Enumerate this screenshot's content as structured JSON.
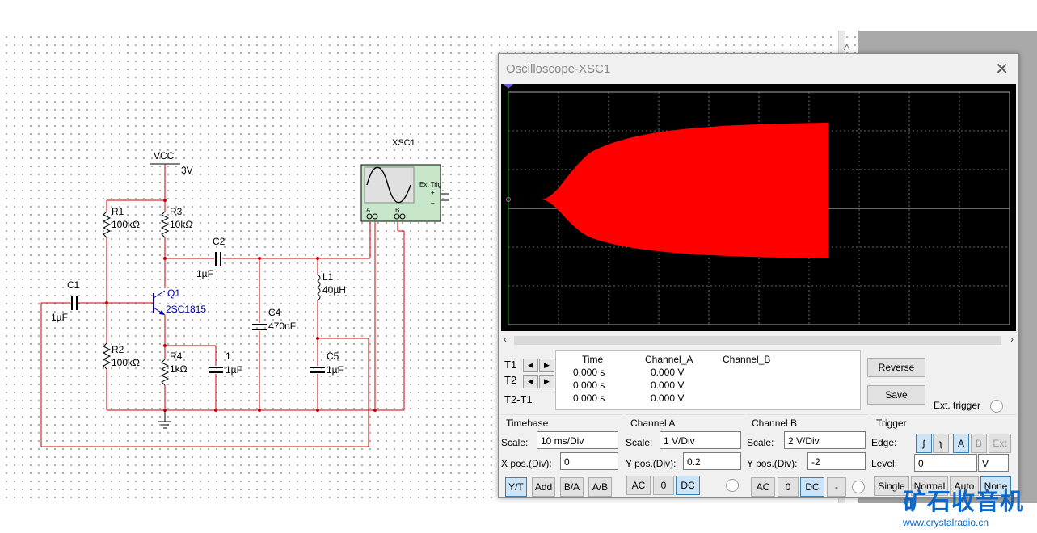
{
  "schematic": {
    "vcc_label": "VCC",
    "vcc_value": "3V",
    "scope_ref": "XSC1",
    "scope_ext_trig": "Ext Trig",
    "scope_a": "A",
    "scope_b": "B",
    "scope_plus": "+",
    "scope_minus": "_",
    "components": {
      "r1_name": "R1",
      "r1_value": "100kΩ",
      "r3_name": "R3",
      "r3_value": "10kΩ",
      "c2_name": "C2",
      "c2_value": "1µF",
      "c1_name": "C1",
      "c1_value": "1µF",
      "q1_name": "Q1",
      "q1_value": "2SC1815",
      "r2_name": "R2",
      "r2_value": "100kΩ",
      "r4_name": "R4",
      "r4_value": "1kΩ",
      "cx_name": "1",
      "cx_value": "1µF",
      "c4_name": "C4",
      "c4_value": "470nF",
      "l1_name": "L1",
      "l1_value": "40µH",
      "c5_name": "C5",
      "c5_value": "1µF"
    },
    "right_edge_letter": "A"
  },
  "oscilloscope": {
    "title": "Oscilloscope-XSC1",
    "trace_color": "#ff0000",
    "cursor": {
      "t1": "T1",
      "t2": "T2",
      "t2t1": "T2-T1",
      "headers": [
        "Time",
        "Channel_A",
        "Channel_B"
      ],
      "rows": [
        [
          "0.000 s",
          "0.000 V",
          ""
        ],
        [
          "0.000 s",
          "0.000 V",
          ""
        ],
        [
          "0.000 s",
          "0.000 V",
          ""
        ]
      ]
    },
    "buttons": {
      "reverse": "Reverse",
      "save": "Save",
      "ext_trigger": "Ext. trigger"
    },
    "timebase": {
      "title": "Timebase",
      "scale_label": "Scale:",
      "scale_value": "10 ms/Div",
      "xpos_label": "X pos.(Div):",
      "xpos_value": "0",
      "modes": [
        "Y/T",
        "Add",
        "B/A",
        "A/B"
      ],
      "selected_mode": "Y/T"
    },
    "channel_a": {
      "title": "Channel A",
      "scale_label": "Scale:",
      "scale_value": "1  V/Div",
      "ypos_label": "Y pos.(Div):",
      "ypos_value": "0.2",
      "coupling": [
        "AC",
        "0",
        "DC"
      ],
      "selected_coupling": "DC"
    },
    "channel_b": {
      "title": "Channel B",
      "scale_label": "Scale:",
      "scale_value": "2  V/Div",
      "ypos_label": "Y pos.(Div):",
      "ypos_value": "-2",
      "coupling": [
        "AC",
        "0",
        "DC",
        "-"
      ],
      "selected_coupling": "DC"
    },
    "trigger": {
      "title": "Trigger",
      "edge_label": "Edge:",
      "edge_rise": "ʃ",
      "edge_fall": "ʅ",
      "sources": [
        "A",
        "B",
        "Ext"
      ],
      "selected_source": "A",
      "level_label": "Level:",
      "level_value": "0",
      "level_unit": "V",
      "modes": [
        "Single",
        "Normal",
        "Auto",
        "None"
      ],
      "selected_mode": "None"
    }
  },
  "watermark": {
    "cn_text": "矿石收音机",
    "url": "www.crystalradio.cn"
  }
}
